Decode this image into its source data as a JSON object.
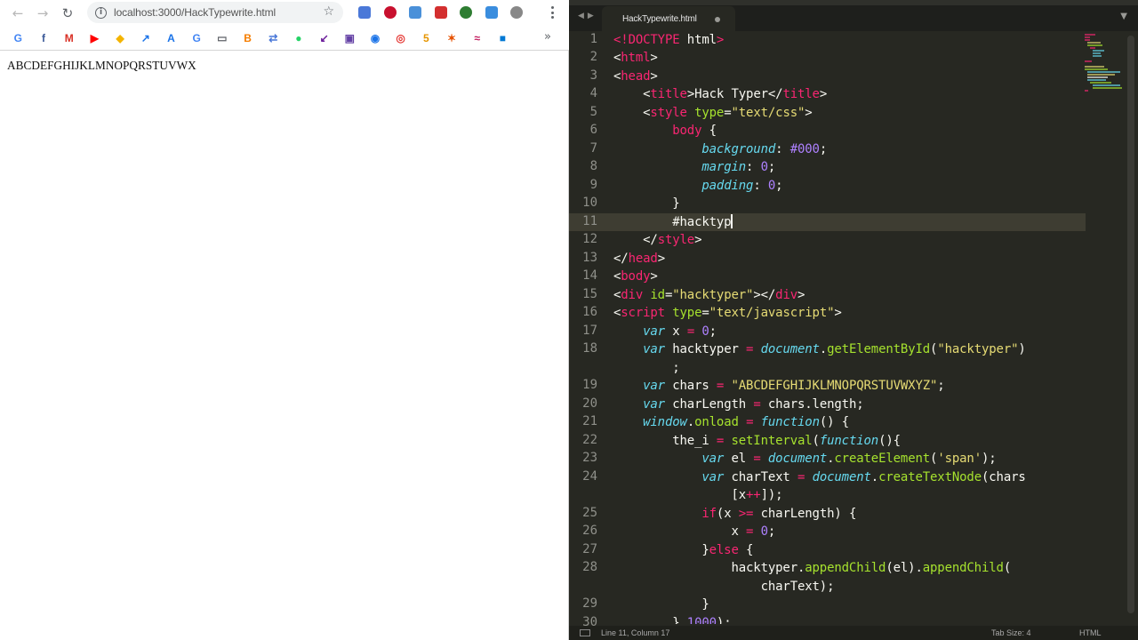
{
  "browser": {
    "url": "localhost:3000/HackTypewrite.html",
    "page_text": "ABCDEFGHIJKLMNOPQRSTUVWX",
    "nav": {
      "back": "←",
      "forward": "→",
      "reload": "↻"
    },
    "extensions": [
      {
        "name": "translate-ext-icon",
        "color": "#4a78d8"
      },
      {
        "name": "adblock-ext-icon",
        "color": "#c8102e"
      },
      {
        "name": "bookmark-ext-icon",
        "color": "#4a90d9"
      },
      {
        "name": "pdf-ext-icon",
        "color": "#d32f2f"
      },
      {
        "name": "globe-ext-icon",
        "color": "#2e7d32"
      },
      {
        "name": "iq-ext-icon",
        "color": "#3a8dde"
      },
      {
        "name": "avatar-ext-icon",
        "color": "#888888"
      }
    ],
    "bookmarks": [
      {
        "label": "G",
        "color": "#4285f4"
      },
      {
        "label": "f",
        "color": "#3b5998"
      },
      {
        "label": "M",
        "color": "#d93025"
      },
      {
        "label": "▶",
        "color": "#ff0000"
      },
      {
        "label": "◆",
        "color": "#f4b400"
      },
      {
        "label": "↗",
        "color": "#1a73e8"
      },
      {
        "label": "A",
        "color": "#1a73e8"
      },
      {
        "label": "G",
        "color": "#4285f4"
      },
      {
        "label": "▭",
        "color": "#5f6368"
      },
      {
        "label": "B",
        "color": "#f57d00"
      },
      {
        "label": "⇄",
        "color": "#4a78d8"
      },
      {
        "label": "●",
        "color": "#25d366"
      },
      {
        "label": "↙",
        "color": "#6a1b9a"
      },
      {
        "label": "▣",
        "color": "#6441a5"
      },
      {
        "label": "◉",
        "color": "#1a73e8"
      },
      {
        "label": "◎",
        "color": "#e53935"
      },
      {
        "label": "5",
        "color": "#e69500"
      },
      {
        "label": "✶",
        "color": "#e65100"
      },
      {
        "label": "≈",
        "color": "#c2185b"
      },
      {
        "label": "■",
        "color": "#0078d4"
      }
    ]
  },
  "editor": {
    "tab_name": "HackTypewrite.html",
    "status": {
      "position": "Line 11, Column 17",
      "tab_size": "Tab Size: 4",
      "syntax": "HTML"
    },
    "line_numbers": [
      "1",
      "2",
      "3",
      "4",
      "5",
      "6",
      "7",
      "8",
      "9",
      "10",
      "11",
      "12",
      "13",
      "14",
      "15",
      "16",
      "17",
      "18",
      "",
      "19",
      "20",
      "21",
      "22",
      "23",
      "24",
      "",
      "25",
      "26",
      "27",
      "28",
      "",
      "29",
      "30"
    ]
  }
}
